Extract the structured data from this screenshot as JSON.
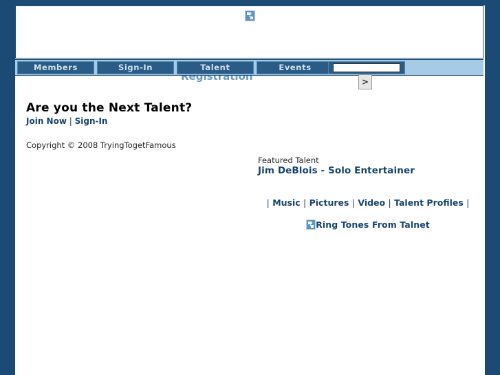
{
  "site": {
    "name": "TryingTogetFamous",
    "tagline": "Registration"
  },
  "header": {
    "logo_icon": "broken-image-icon"
  },
  "nav": {
    "items": [
      {
        "label": "Members"
      },
      {
        "label": "Sign-In"
      },
      {
        "label": "Talent"
      },
      {
        "label": "Events"
      }
    ],
    "search": {
      "value": "",
      "placeholder": "",
      "submit_label": ">"
    }
  },
  "cta": {
    "heading": "Are you the Next Talent?",
    "join_label": "Join Now",
    "separator": "|",
    "signin_label": "Sign-In"
  },
  "footer": {
    "copyright": "Copyright © 2008 TryingTogetFamous"
  },
  "featured": {
    "label": "Featured Talent",
    "name": "Jim DeBlois - Solo Entertainer"
  },
  "media_links": {
    "lead_pipe": "|",
    "items": [
      {
        "label": "Music"
      },
      {
        "label": "Pictures"
      },
      {
        "label": "Video"
      },
      {
        "label": "Talent Profiles"
      }
    ],
    "separator": "|",
    "trail_pipe": "|"
  },
  "ringtones": {
    "icon": "broken-image-icon",
    "label": "Ring Tones From Talnet"
  },
  "colors": {
    "page_background": "#1b4b75",
    "nav_strip": "#a5cbe6",
    "nav_button": "#2b5c85",
    "nav_button_border": "#4e86b0",
    "nav_text": "#cfe3f2",
    "link_blue": "#17436b",
    "tagline_blue": "#6a9bc3",
    "content_background": "#ffffff"
  }
}
